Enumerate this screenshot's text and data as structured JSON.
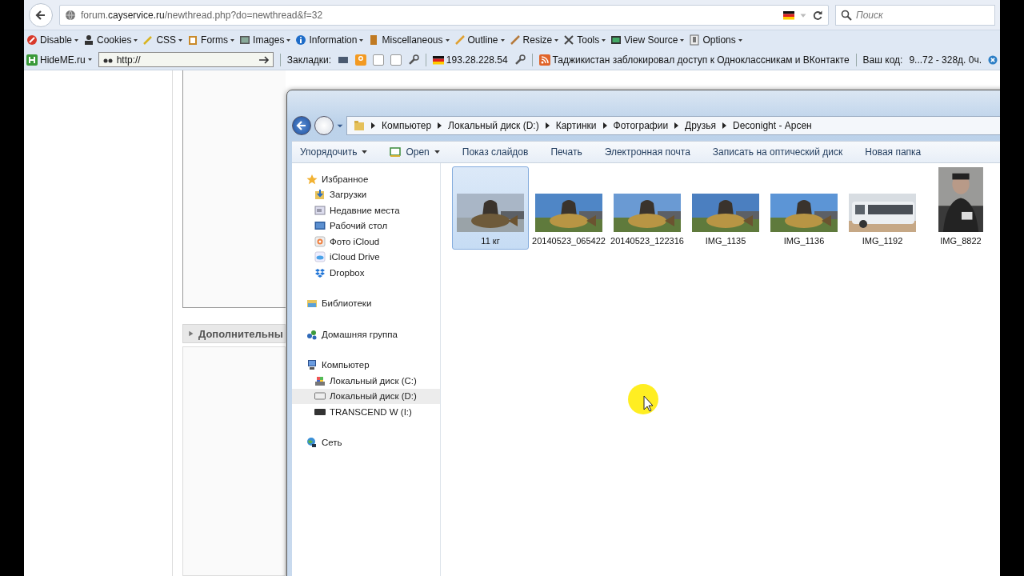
{
  "browser": {
    "url_host": "forum.",
    "url_domain": "cayservice.ru",
    "url_path": "/newthread.php?do=newthread&f=32",
    "search_placeholder": "Поиск",
    "dev_toolbar": [
      {
        "label": "Disable"
      },
      {
        "label": "Cookies"
      },
      {
        "label": "CSS"
      },
      {
        "label": "Forms"
      },
      {
        "label": "Images"
      },
      {
        "label": "Information"
      },
      {
        "label": "Miscellaneous"
      },
      {
        "label": "Outline"
      },
      {
        "label": "Resize"
      },
      {
        "label": "Tools"
      },
      {
        "label": "View Source"
      },
      {
        "label": "Options"
      }
    ],
    "bookmarks_bar": {
      "proxy_label": "HideME.ru",
      "proxy_value": "http://",
      "bookmarks_label": "Закладки:",
      "ip": "193.28.228.54",
      "news": "Таджикистан заблокировал доступ к Одноклассникам и ВКонтакте",
      "code_label": "Ваш код:",
      "code_value": "9...72 - 328д. 0ч."
    }
  },
  "page": {
    "section_title": "Дополнительны"
  },
  "explorer": {
    "breadcrumbs": [
      "Компьютер",
      "Локальный диск (D:)",
      "Картинки",
      "Фотографии",
      "Друзья",
      "Deconight - Арсен"
    ],
    "commands": [
      {
        "label": "Упорядочить",
        "dropdown": true
      },
      {
        "label": "Open",
        "dropdown": true
      },
      {
        "label": "Показ слайдов",
        "dropdown": false
      },
      {
        "label": "Печать",
        "dropdown": false
      },
      {
        "label": "Электронная почта",
        "dropdown": false
      },
      {
        "label": "Записать на оптический диск",
        "dropdown": false
      },
      {
        "label": "Новая папка",
        "dropdown": false
      }
    ],
    "nav": [
      {
        "label": "Избранное",
        "selected": false,
        "children": [
          {
            "label": "Загрузки",
            "selected": false
          },
          {
            "label": "Недавние места",
            "selected": false
          },
          {
            "label": "Рабочий стол",
            "selected": false
          },
          {
            "label": "Фото iCloud",
            "selected": false
          },
          {
            "label": "iCloud Drive",
            "selected": false
          },
          {
            "label": "Dropbox",
            "selected": false
          }
        ]
      },
      {
        "label": "Библиотеки",
        "selected": false
      },
      {
        "label": "Домашняя группа",
        "selected": false
      },
      {
        "label": "Компьютер",
        "selected": false,
        "children": [
          {
            "label": "Локальный диск (C:)",
            "selected": false
          },
          {
            "label": "Локальный диск (D:)",
            "selected": true
          },
          {
            "label": "TRANSCEND W (I:)",
            "selected": false
          }
        ]
      },
      {
        "label": "Сеть",
        "selected": false
      }
    ],
    "files": [
      {
        "name": "11 кг",
        "selected": true,
        "kind": "picture"
      },
      {
        "name": "20140523_065422",
        "selected": false,
        "kind": "picture"
      },
      {
        "name": "20140523_122316",
        "selected": false,
        "kind": "picture"
      },
      {
        "name": "IMG_1135",
        "selected": false,
        "kind": "picture"
      },
      {
        "name": "IMG_1136",
        "selected": false,
        "kind": "picture"
      },
      {
        "name": "IMG_1192",
        "selected": false,
        "kind": "picture"
      },
      {
        "name": "IMG_8822",
        "selected": false,
        "kind": "portrait"
      }
    ]
  }
}
